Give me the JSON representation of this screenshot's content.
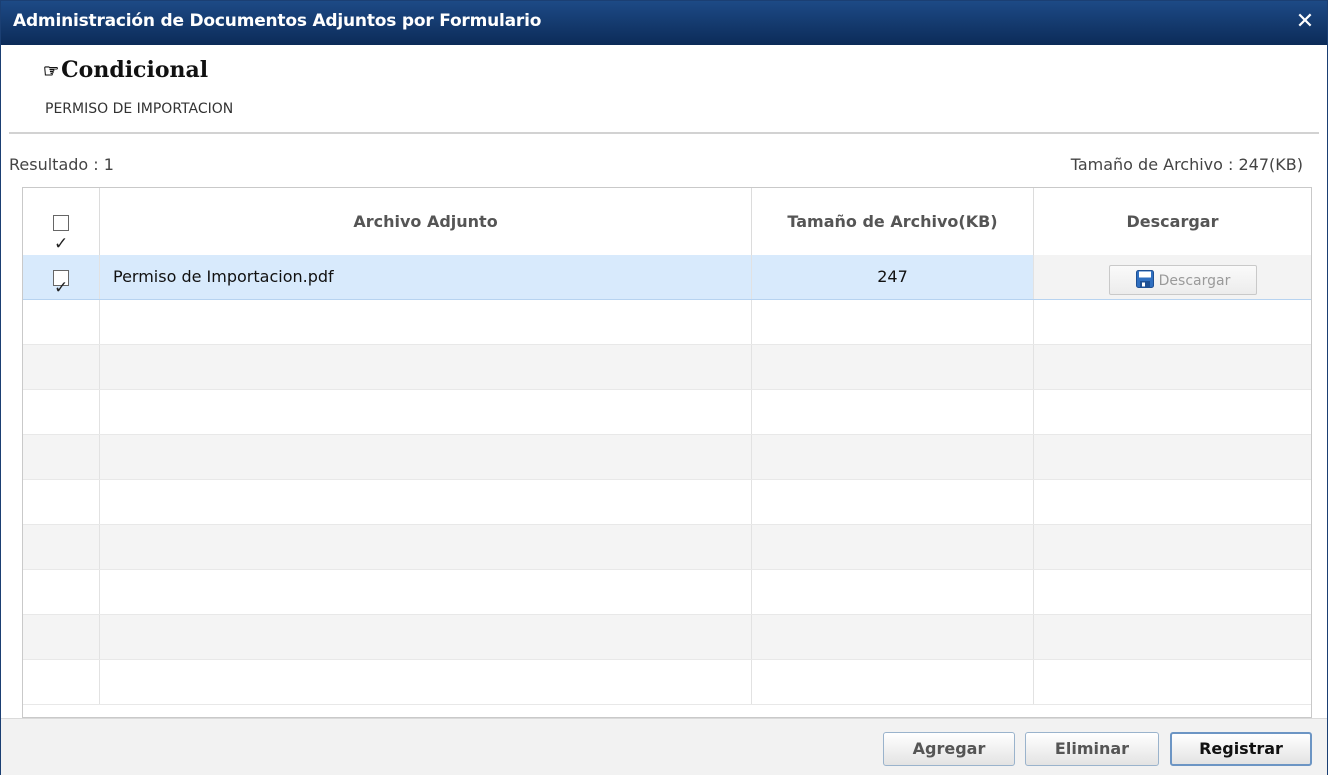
{
  "dialog": {
    "title": "Administración de Documentos Adjuntos por Formulario",
    "close_label": "✕"
  },
  "condition": {
    "title": "Condicional",
    "subtitle": "PERMISO DE IMPORTACION"
  },
  "summary": {
    "result_label": "Resultado : 1",
    "total_size_label": "Tamaño de Archivo : 247(KB)"
  },
  "grid": {
    "headers": [
      "Archivo Adjunto",
      "Tamaño de Archivo(KB)",
      "Descargar"
    ],
    "header_all_checked": true,
    "rows": [
      {
        "checked": true,
        "file_name": "Permiso de Importacion.pdf",
        "size": "247",
        "download_label": "Descargar"
      }
    ],
    "empty_rows": 9
  },
  "footer": {
    "add_label": "Agregar",
    "delete_label": "Eliminar",
    "register_label": "Registrar"
  },
  "colors": {
    "titlebar": "#0c2b58",
    "selected_row": "#d8eafc",
    "floppy_blue": "#2f6fc0"
  },
  "icons": {
    "close": "close-icon",
    "pointer": "pointing-hand-icon",
    "download": "floppy-disk-icon"
  }
}
